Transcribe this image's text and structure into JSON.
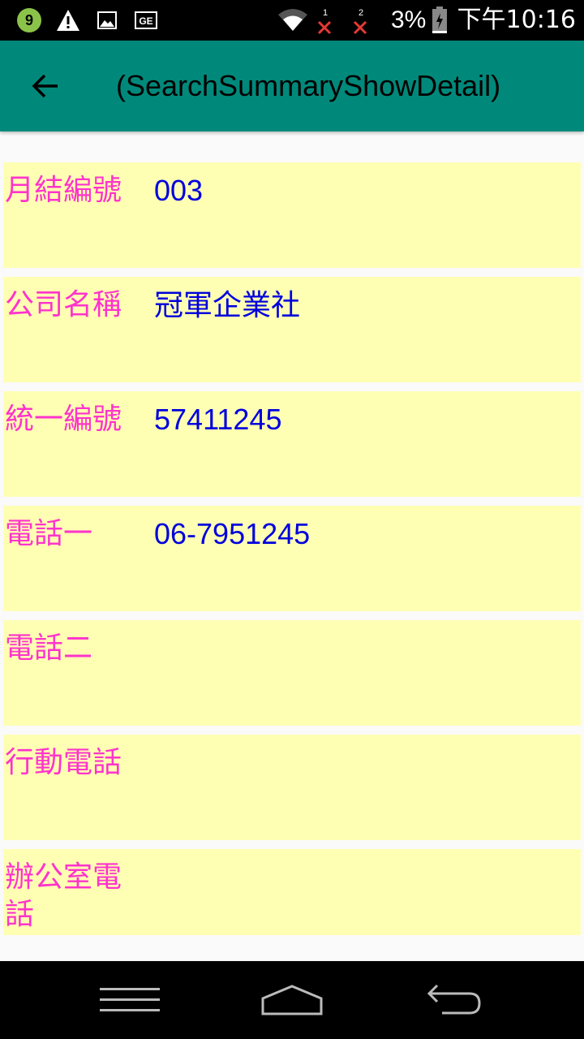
{
  "status_bar": {
    "app_badge": "9",
    "battery_percent": "3%",
    "time": "下午10:16",
    "sim1_label": "1",
    "sim2_label": "2",
    "icons": [
      "app-notification-icon",
      "warning-icon",
      "image-icon",
      "ge-icon",
      "wifi-icon",
      "sim1-no-signal-icon",
      "sim2-no-signal-icon",
      "battery-icon"
    ]
  },
  "app_bar": {
    "title": "(SearchSummaryShowDetail)",
    "back_icon": "arrow-back-icon",
    "color": "#00897b"
  },
  "fields": [
    {
      "label": "月結編號",
      "value": "003"
    },
    {
      "label": "公司名稱",
      "value": "冠軍企業社"
    },
    {
      "label": "統一編號",
      "value": "57411245"
    },
    {
      "label": "電話一",
      "value": "06-7951245"
    },
    {
      "label": "電話二",
      "value": ""
    },
    {
      "label": "行動電話",
      "value": ""
    },
    {
      "label": "辦公室電話",
      "value": ""
    }
  ],
  "colors": {
    "row_background": "#ffffb4",
    "label_color": "#ff33cc",
    "value_color": "#0000dd"
  },
  "nav_bar": {
    "icons": [
      "recent-apps-icon",
      "home-icon",
      "back-icon"
    ]
  }
}
